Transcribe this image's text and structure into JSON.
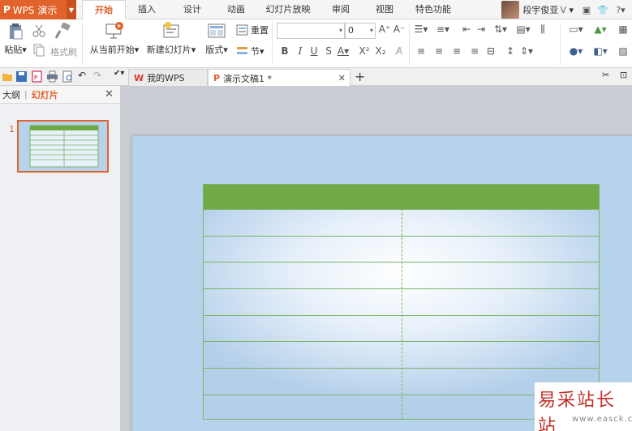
{
  "app": {
    "name": "WPS 演示",
    "logo": "P"
  },
  "menu": {
    "tabs": [
      "开始",
      "插入",
      "设计",
      "动画",
      "幻灯片放映",
      "审阅",
      "视图",
      "特色功能"
    ],
    "active": "开始"
  },
  "user": {
    "name": "段宇俊亚",
    "badge": "V"
  },
  "ribbon": {
    "paste": "粘贴",
    "format_painter": "格式刷",
    "from_current": "从当前开始",
    "new_slide": "新建幻灯片",
    "layout": "版式",
    "reset": "重置",
    "section": "节",
    "font_size": "0"
  },
  "doc_tabs": [
    {
      "label": "我的WPS"
    },
    {
      "label": "演示文稿1 *"
    }
  ],
  "left_panel": {
    "tab_outline": "大纲",
    "tab_slides": "幻灯片",
    "slide_number": "1"
  },
  "watermark": {
    "text": "易采站长站",
    "url": "www.easck.com"
  },
  "colors": {
    "accent": "#e2622b",
    "table_header": "#6faa46",
    "table_border": "#7ab565",
    "slide_bg": "#b7d3ec"
  },
  "table": {
    "rows": 8,
    "cols": 2
  }
}
